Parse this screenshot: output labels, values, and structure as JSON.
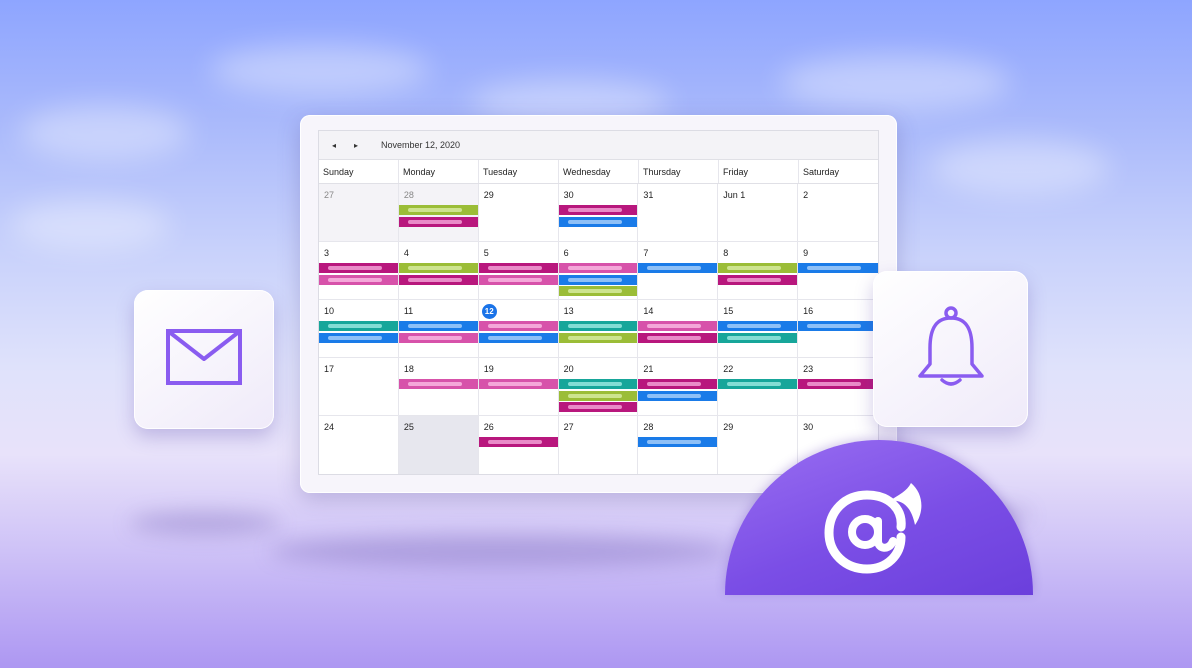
{
  "calendar": {
    "nav_prev": "◂",
    "nav_next": "▸",
    "current_date": "November 12, 2020",
    "weekdays": [
      "Sunday",
      "Monday",
      "Tuesday",
      "Wednesday",
      "Thursday",
      "Friday",
      "Saturday"
    ],
    "weeks": [
      [
        {
          "day": "27",
          "other": true,
          "events": []
        },
        {
          "day": "28",
          "other": true,
          "events": [
            "green",
            "magenta"
          ]
        },
        {
          "day": "29",
          "events": []
        },
        {
          "day": "30",
          "events": [
            "magenta",
            "blue"
          ]
        },
        {
          "day": "31",
          "events": []
        },
        {
          "day": "Jun 1",
          "events": []
        },
        {
          "day": "2",
          "events": []
        }
      ],
      [
        {
          "day": "3",
          "events": [
            "magenta",
            "pink"
          ]
        },
        {
          "day": "4",
          "events": [
            "green",
            "magenta"
          ]
        },
        {
          "day": "5",
          "events": [
            "magenta",
            "pink"
          ]
        },
        {
          "day": "6",
          "events": [
            "pink",
            "blue",
            "green"
          ]
        },
        {
          "day": "7",
          "events": [
            "blue"
          ]
        },
        {
          "day": "8",
          "events": [
            "green",
            "magenta"
          ]
        },
        {
          "day": "9",
          "events": [
            "blue"
          ]
        }
      ],
      [
        {
          "day": "10",
          "events": [
            "teal",
            "blue"
          ]
        },
        {
          "day": "11",
          "events": [
            "blue",
            "pink"
          ]
        },
        {
          "day": "12",
          "today": true,
          "events": [
            "pink",
            "blue"
          ]
        },
        {
          "day": "13",
          "events": [
            "teal",
            "green"
          ]
        },
        {
          "day": "14",
          "events": [
            "pink",
            "magenta"
          ]
        },
        {
          "day": "15",
          "events": [
            "blue",
            "teal"
          ]
        },
        {
          "day": "16",
          "events": [
            "blue"
          ]
        }
      ],
      [
        {
          "day": "17",
          "events": []
        },
        {
          "day": "18",
          "events": [
            "pink"
          ]
        },
        {
          "day": "19",
          "events": [
            "pink"
          ]
        },
        {
          "day": "20",
          "events": [
            "teal",
            "green",
            "magenta"
          ]
        },
        {
          "day": "21",
          "events": [
            "magenta",
            "blue"
          ]
        },
        {
          "day": "22",
          "events": [
            "teal"
          ]
        },
        {
          "day": "23",
          "events": [
            "magenta"
          ]
        }
      ],
      [
        {
          "day": "24",
          "events": []
        },
        {
          "day": "25",
          "selected": true,
          "events": []
        },
        {
          "day": "26",
          "events": [
            "magenta"
          ]
        },
        {
          "day": "27",
          "events": []
        },
        {
          "day": "28",
          "events": [
            "blue"
          ]
        },
        {
          "day": "29",
          "events": []
        },
        {
          "day": "30",
          "events": []
        }
      ]
    ]
  },
  "event_colors": {
    "magenta": {
      "bar": "#b8177d",
      "pill": "#e98bc8"
    },
    "pink": {
      "bar": "#d752aa",
      "pill": "#f4a7d9"
    },
    "green": {
      "bar": "#9bbd37",
      "pill": "#cde48f"
    },
    "blue": {
      "bar": "#1a7be8",
      "pill": "#8ec0f7"
    },
    "teal": {
      "bar": "#17a69a",
      "pill": "#84ddd4"
    }
  },
  "icons": {
    "mail_tile": "envelope-icon",
    "bell_tile": "bell-icon",
    "logo": "blazor-logo-icon"
  },
  "colors": {
    "accent_purple": "#8a5cf0",
    "today_blue": "#1a73e8"
  }
}
